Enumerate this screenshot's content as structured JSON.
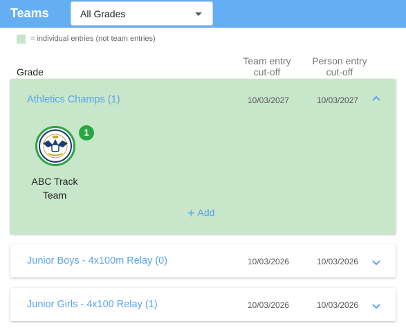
{
  "header": {
    "title": "Teams",
    "grade_select": {
      "value": "All Grades"
    }
  },
  "legend": {
    "text": "= individual entries (not team entries)",
    "color": "#c8e6c9"
  },
  "columns": {
    "grade": "Grade",
    "team_cutoff_line1": "Team entry",
    "team_cutoff_line2": "cut-off",
    "person_cutoff_line1": "Person entry",
    "person_cutoff_line2": "cut-off"
  },
  "grades": [
    {
      "name": "Athletics Champs (1)",
      "team_cutoff": "10/03/2027",
      "person_cutoff": "10/03/2027",
      "expanded": true,
      "individual": true,
      "teams": [
        {
          "name_line1": "ABC Track",
          "name_line2": "Team",
          "badge": "1"
        }
      ],
      "add_label": "Add"
    },
    {
      "name": "Junior Boys - 4x100m Relay (0)",
      "team_cutoff": "10/03/2026",
      "person_cutoff": "10/03/2026",
      "expanded": false
    },
    {
      "name": "Junior Girls - 4x100 Relay (1)",
      "team_cutoff": "10/03/2026",
      "person_cutoff": "10/03/2026",
      "expanded": false
    }
  ],
  "colors": {
    "header": "#64aef3",
    "link": "#5aa4ec",
    "green": "#2aa542"
  },
  "icons": {
    "select_caret": "caret-down-icon",
    "collapse": "chevron-up-icon",
    "expand": "chevron-down-icon",
    "add": "plus-icon"
  }
}
